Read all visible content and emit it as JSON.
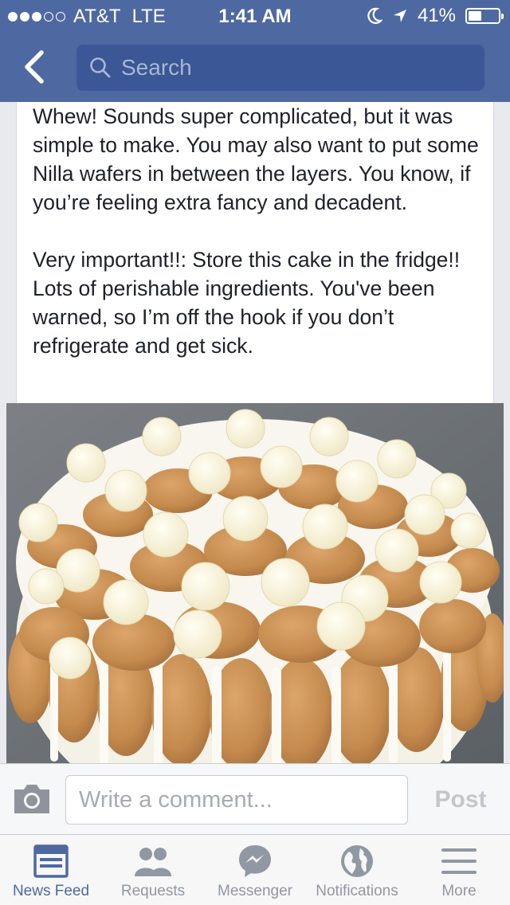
{
  "status_bar": {
    "carrier": "AT&T",
    "network": "LTE",
    "time": "1:41 AM",
    "battery": "41%",
    "battery_level": 0.41,
    "signal_bars": 3,
    "signal_max": 5
  },
  "nav": {
    "back_icon": "chevron-left-icon",
    "search_placeholder": "Search"
  },
  "post": {
    "paragraphs": [
      "Whew! Sounds super complicated, but it was simple to make. You may also want to put some Nilla wafers in between the layers. You know, if you’re feeling extra fancy and decadent.",
      "Very important!!: Store this cake in the fridge!! Lots of perishable ingredients. You've been warned, so I’m off the hook if you don’t refrigerate and get sick."
    ]
  },
  "comment_bar": {
    "camera_icon": "camera-icon",
    "placeholder": "Write a comment...",
    "post_label": "Post"
  },
  "tabs": [
    {
      "label": "News Feed",
      "icon": "news-feed-icon",
      "active": true
    },
    {
      "label": "Requests",
      "icon": "requests-icon",
      "active": false
    },
    {
      "label": "Messenger",
      "icon": "messenger-icon",
      "active": false
    },
    {
      "label": "Notifications",
      "icon": "globe-icon",
      "active": false
    },
    {
      "label": "More",
      "icon": "menu-icon",
      "active": false
    }
  ],
  "colors": {
    "brand": "#4e69a2",
    "search_bg": "#3b5795",
    "text": "#1d2129",
    "inactive": "#9197a3"
  }
}
